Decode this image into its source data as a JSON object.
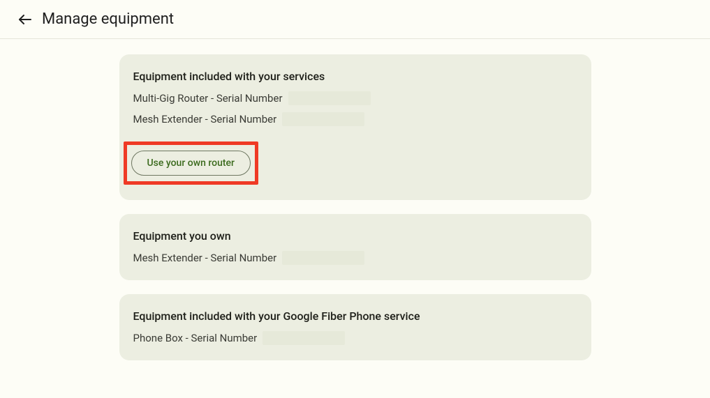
{
  "header": {
    "title": "Manage equipment"
  },
  "cards": {
    "included": {
      "title": "Equipment included with your services",
      "items": [
        {
          "label": "Multi-Gig Router - Serial Number"
        },
        {
          "label": "Mesh Extender - Serial Number"
        }
      ],
      "button": {
        "label": "Use your own router"
      }
    },
    "owned": {
      "title": "Equipment you own",
      "items": [
        {
          "label": "Mesh Extender - Serial Number"
        }
      ]
    },
    "phone": {
      "title": "Equipment included with your Google Fiber Phone service",
      "items": [
        {
          "label": "Phone Box - Serial Number"
        }
      ]
    }
  }
}
